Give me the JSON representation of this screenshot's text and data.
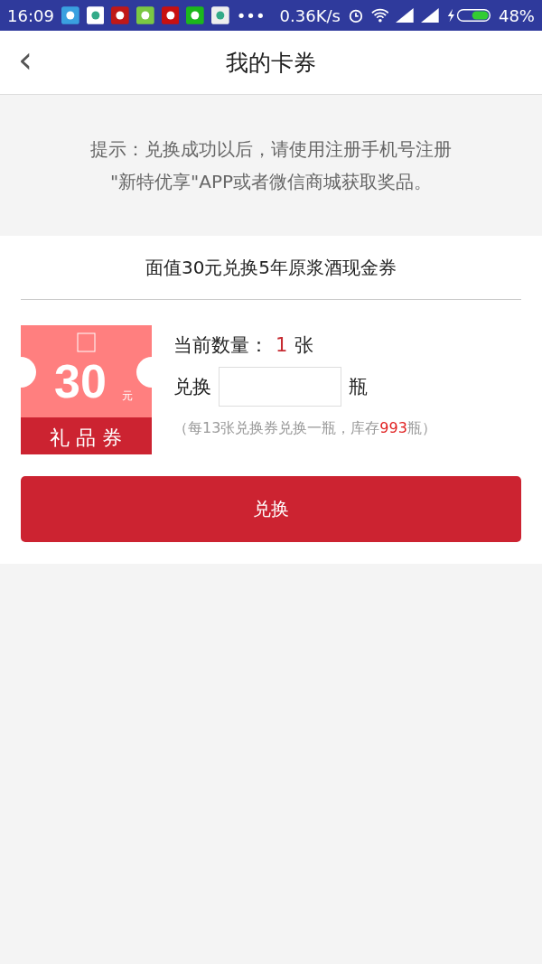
{
  "status_bar": {
    "time": "16:09",
    "speed": "0.36K/s",
    "more": "•••",
    "battery": "48%"
  },
  "header": {
    "back": "‹",
    "title": "我的卡券"
  },
  "hint": {
    "lines": [
      "提示：兑换成功以后，请使用注册手机号注册",
      "\"新特优享\"APP或者微信商城获取奖品。"
    ]
  },
  "voucher": {
    "title": "面值30元兑换5年原浆酒现金券",
    "amount": "30",
    "unit": "元",
    "label": "礼 品 券",
    "count_label": "当前数量：",
    "count": "1",
    "count_unit": "张",
    "exchange_label": "兑换",
    "exchange_unit": "瓶",
    "note_prefix": "（每13张兑换券兑换一瓶，库存",
    "stock": "993",
    "note_suffix": "瓶）"
  },
  "submit": "兑换"
}
